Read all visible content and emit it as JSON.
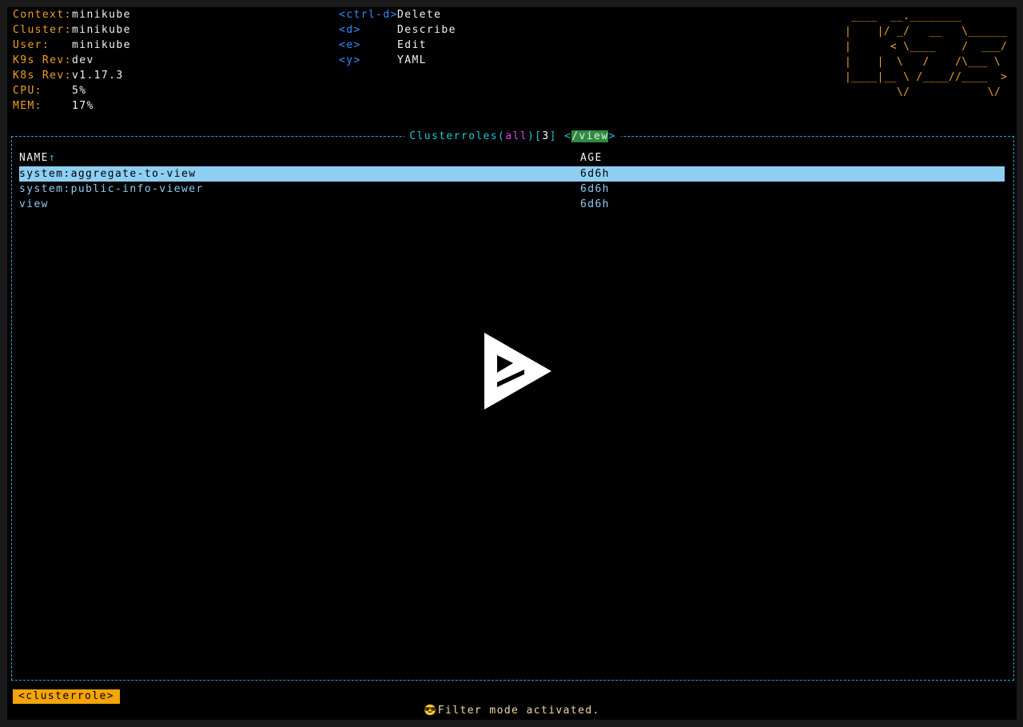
{
  "header": {
    "info": [
      {
        "key": "Context:",
        "value": "minikube"
      },
      {
        "key": "Cluster:",
        "value": "minikube"
      },
      {
        "key": "User:",
        "value": "minikube"
      },
      {
        "key": "K9s Rev:",
        "value": "dev"
      },
      {
        "key": "K8s Rev:",
        "value": "v1.17.3"
      },
      {
        "key": "CPU:",
        "value": "5%"
      },
      {
        "key": "MEM:",
        "value": "17%"
      }
    ],
    "menu": [
      {
        "key": "<ctrl-d>",
        "action": "Delete"
      },
      {
        "key": "<d>",
        "action": "Describe"
      },
      {
        "key": "<e>",
        "action": "Edit"
      },
      {
        "key": "<y>",
        "action": "YAML"
      }
    ],
    "logo": " ____  __.________\n|    |/ _/   __   \\______\n|      < \\____    /  ___/\n|    |  \\   /    /\\___ \\\n|____|__ \\ /____//____  >\n        \\/            \\/"
  },
  "table": {
    "title": {
      "resource": "Clusterroles",
      "namespace": "all",
      "count": "3",
      "filter": "/view"
    },
    "columns": [
      "NAME",
      "AGE"
    ],
    "sort_arrow": "↑",
    "rows": [
      {
        "name": "system:aggregate-to-view",
        "age": "6d6h",
        "selected": true
      },
      {
        "name": "system:public-info-viewer",
        "age": "6d6h",
        "selected": false
      },
      {
        "name": "view",
        "age": "6d6h",
        "selected": false
      }
    ]
  },
  "footer": {
    "crumb": "<clusterrole>",
    "flash": "😎Filter mode activated."
  },
  "colors": {
    "accent_orange": "#f0a020",
    "hotkey_blue": "#2f8dff",
    "border_cyan": "#2aa8cc",
    "row_text": "#8ecaf0",
    "selected_row_bg": "#8ecff3",
    "filter_bg": "#2e8b40",
    "crumb_bg": "#f5a50a"
  },
  "overlay": {
    "icon": "play-icon"
  }
}
